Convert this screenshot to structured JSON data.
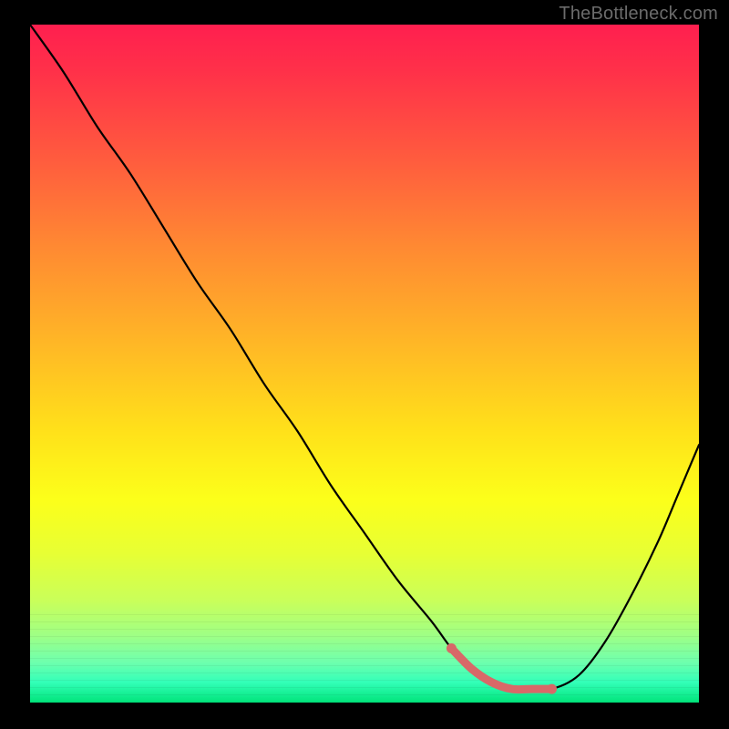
{
  "watermark": "TheBottleneck.com",
  "colors": {
    "frame": "#000000",
    "curve": "#000000",
    "valley_highlight": "#d86868",
    "gradient_top": "#ff1f4f",
    "gradient_bottom": "#00e47a"
  },
  "chart_data": {
    "type": "line",
    "title": "",
    "xlabel": "",
    "ylabel": "",
    "xlim": [
      0,
      100
    ],
    "ylim": [
      0,
      100
    ],
    "grid": false,
    "legend": false,
    "background": "rainbow-gradient (red→green, top→bottom)",
    "series": [
      {
        "name": "bottleneck-curve",
        "x": [
          0,
          5,
          10,
          15,
          20,
          25,
          30,
          35,
          40,
          45,
          50,
          55,
          60,
          63,
          66,
          69,
          72,
          75,
          78,
          82,
          86,
          90,
          94,
          97,
          100
        ],
        "values": [
          100,
          93,
          85,
          78,
          70,
          62,
          55,
          47,
          40,
          32,
          25,
          18,
          12,
          8,
          5,
          3,
          2,
          2,
          2,
          4,
          9,
          16,
          24,
          31,
          38
        ]
      }
    ],
    "annotations": [
      {
        "name": "valley-highlight",
        "type": "segment",
        "color": "#d86868",
        "x_start": 63,
        "x_end": 78,
        "note": "thick coral segment along the flat bottom of the curve with round endpoint dots"
      }
    ]
  }
}
